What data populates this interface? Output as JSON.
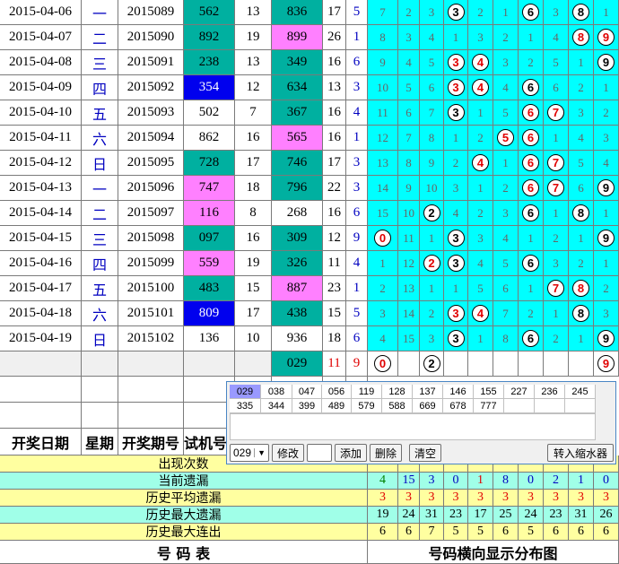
{
  "rows": [
    {
      "date": "2015-04-06",
      "weekday": "一",
      "period": "2015089",
      "trial": "562",
      "span": "13",
      "draw": "836",
      "sum": "17",
      "small": "5",
      "dist": [
        "7",
        "2",
        "3",
        "3",
        "2",
        "1",
        "6",
        "3",
        "8",
        "1"
      ],
      "hits": [
        3,
        6,
        8
      ]
    },
    {
      "date": "2015-04-07",
      "weekday": "二",
      "period": "2015090",
      "trial": "892",
      "span": "19",
      "draw": "899",
      "sum": "26",
      "small": "1",
      "dist": [
        "8",
        "3",
        "4",
        "1",
        "3",
        "2",
        "1",
        "4",
        "8",
        "9"
      ],
      "hits": [
        8,
        9
      ]
    },
    {
      "date": "2015-04-08",
      "weekday": "三",
      "period": "2015091",
      "trial": "238",
      "span": "13",
      "draw": "349",
      "sum": "16",
      "small": "6",
      "dist": [
        "9",
        "4",
        "5",
        "3",
        "4",
        "3",
        "2",
        "5",
        "1",
        "9"
      ],
      "hits": [
        3,
        4,
        9
      ]
    },
    {
      "date": "2015-04-09",
      "weekday": "四",
      "period": "2015092",
      "trial": "354",
      "span": "12",
      "draw": "634",
      "sum": "13",
      "small": "3",
      "dist": [
        "10",
        "5",
        "6",
        "3",
        "4",
        "4",
        "6",
        "6",
        "2",
        "1"
      ],
      "hits": [
        3,
        4,
        6
      ]
    },
    {
      "date": "2015-04-10",
      "weekday": "五",
      "period": "2015093",
      "trial": "502",
      "span": "7",
      "draw": "367",
      "sum": "16",
      "small": "4",
      "dist": [
        "11",
        "6",
        "7",
        "3",
        "1",
        "5",
        "6",
        "7",
        "3",
        "2"
      ],
      "hits": [
        3,
        6,
        7
      ]
    },
    {
      "date": "2015-04-11",
      "weekday": "六",
      "period": "2015094",
      "trial": "862",
      "span": "16",
      "draw": "565",
      "sum": "16",
      "small": "1",
      "dist": [
        "12",
        "7",
        "8",
        "1",
        "2",
        "5",
        "6",
        "1",
        "4",
        "3"
      ],
      "hits": [
        5,
        6
      ]
    },
    {
      "date": "2015-04-12",
      "weekday": "日",
      "period": "2015095",
      "trial": "728",
      "span": "17",
      "draw": "746",
      "sum": "17",
      "small": "3",
      "dist": [
        "13",
        "8",
        "9",
        "2",
        "4",
        "1",
        "6",
        "7",
        "5",
        "4"
      ],
      "hits": [
        4,
        6,
        7
      ]
    },
    {
      "date": "2015-04-13",
      "weekday": "一",
      "period": "2015096",
      "trial": "747",
      "span": "18",
      "draw": "796",
      "sum": "22",
      "small": "3",
      "dist": [
        "14",
        "9",
        "10",
        "3",
        "1",
        "2",
        "6",
        "7",
        "6",
        "9"
      ],
      "hits": [
        6,
        7,
        9
      ]
    },
    {
      "date": "2015-04-14",
      "weekday": "二",
      "period": "2015097",
      "trial": "116",
      "span": "8",
      "draw": "268",
      "sum": "16",
      "small": "6",
      "dist": [
        "15",
        "10",
        "2",
        "4",
        "2",
        "3",
        "6",
        "1",
        "8",
        "1"
      ],
      "hits": [
        2,
        6,
        8
      ]
    },
    {
      "date": "2015-04-15",
      "weekday": "三",
      "period": "2015098",
      "trial": "097",
      "span": "16",
      "draw": "309",
      "sum": "12",
      "small": "9",
      "dist": [
        "0",
        "11",
        "1",
        "3",
        "3",
        "4",
        "1",
        "2",
        "1",
        "9"
      ],
      "hits": [
        0,
        3,
        9
      ]
    },
    {
      "date": "2015-04-16",
      "weekday": "四",
      "period": "2015099",
      "trial": "559",
      "span": "19",
      "draw": "326",
      "sum": "11",
      "small": "4",
      "dist": [
        "1",
        "12",
        "2",
        "3",
        "4",
        "5",
        "6",
        "3",
        "2",
        "1"
      ],
      "hits": [
        2,
        3,
        6
      ]
    },
    {
      "date": "2015-04-17",
      "weekday": "五",
      "period": "2015100",
      "trial": "483",
      "span": "15",
      "draw": "887",
      "sum": "23",
      "small": "1",
      "dist": [
        "2",
        "13",
        "1",
        "1",
        "5",
        "6",
        "1",
        "7",
        "8",
        "2"
      ],
      "hits": [
        7,
        8
      ]
    },
    {
      "date": "2015-04-18",
      "weekday": "六",
      "period": "2015101",
      "trial": "809",
      "span": "17",
      "draw": "438",
      "sum": "15",
      "small": "5",
      "dist": [
        "3",
        "14",
        "2",
        "3",
        "4",
        "7",
        "2",
        "1",
        "8",
        "3"
      ],
      "hits": [
        3,
        4,
        8
      ]
    },
    {
      "date": "2015-04-19",
      "weekday": "日",
      "period": "2015102",
      "trial": "136",
      "span": "10",
      "draw": "936",
      "sum": "18",
      "small": "6",
      "dist": [
        "4",
        "15",
        "3",
        "3",
        "1",
        "8",
        "6",
        "2",
        "1",
        "9"
      ],
      "hits": [
        3,
        6,
        9
      ]
    }
  ],
  "summary_row": {
    "draw": "029",
    "sum": "11",
    "small": "9",
    "hits": [
      0,
      2,
      9
    ]
  },
  "header": {
    "date": "开奖日期",
    "weekday": "星期",
    "period": "开奖期号",
    "trial": "试机号"
  },
  "stats": [
    {
      "label": "出现次数",
      "values": []
    },
    {
      "label": "当前遗漏",
      "values": [
        "4",
        "15",
        "3",
        "0",
        "1",
        "8",
        "0",
        "2",
        "1",
        "0"
      ]
    },
    {
      "label": "历史平均遗漏",
      "values": [
        "3",
        "3",
        "3",
        "3",
        "3",
        "3",
        "3",
        "3",
        "3",
        "3"
      ]
    },
    {
      "label": "历史最大遗漏",
      "values": [
        "19",
        "24",
        "31",
        "23",
        "17",
        "25",
        "24",
        "23",
        "31",
        "26"
      ]
    },
    {
      "label": "历史最大连出",
      "values": [
        "6",
        "6",
        "7",
        "5",
        "5",
        "6",
        "5",
        "6",
        "6",
        "6"
      ]
    }
  ],
  "footer": {
    "left": "号 码 表",
    "right": "号码横向显示分布图"
  },
  "popup": {
    "numbers_row1": [
      "029",
      "038",
      "047",
      "056",
      "119",
      "128",
      "137",
      "146",
      "155",
      "227",
      "236",
      "245"
    ],
    "numbers_row2": [
      "335",
      "344",
      "399",
      "489",
      "579",
      "588",
      "669",
      "678",
      "777"
    ],
    "select_value": "029",
    "buttons": {
      "modify": "修改",
      "add": "添加",
      "delete": "删除",
      "clear": "清空",
      "transfer": "转入缩水器"
    }
  },
  "colors": {
    "cyan": "#00ffff",
    "teal": "#00b0a0",
    "magenta": "#ff80ff",
    "blue": "#0000ee",
    "stat_yellow": "#ffffa0",
    "stat_cyan": "#a0ffe8",
    "red": "#e00000"
  }
}
